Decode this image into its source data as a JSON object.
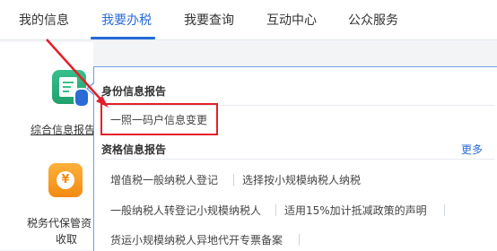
{
  "nav": {
    "tabs": [
      {
        "label": "我的信息"
      },
      {
        "label": "我要办税"
      },
      {
        "label": "我要查询"
      },
      {
        "label": "互动中心"
      },
      {
        "label": "公众服务"
      }
    ],
    "active_tab": "我要办税",
    "accent_color": "#2a6bd6"
  },
  "left_panel": {
    "items": [
      {
        "label": "综合信息报告",
        "icon": "document-mic-icon",
        "color": "#36c08b"
      },
      {
        "label_line1": "税务代保管资",
        "label_line2": "收取",
        "icon": "money-bag-icon",
        "color": "#f38a12"
      }
    ]
  },
  "dropdown": {
    "section1": {
      "title": "身份信息报告",
      "items": [
        "一照一码户信息变更"
      ]
    },
    "section2": {
      "title": "资格信息报告",
      "more": "更多",
      "items": [
        "增值税一般纳税人登记",
        "选择按小规模纳税人纳税",
        "一般纳税人转登记小规模纳税人",
        "适用15%加计抵减政策的声明",
        "货运小规模纳税人异地代开专票备案"
      ]
    }
  },
  "annotation": {
    "highlight_color": "#e3202a"
  }
}
